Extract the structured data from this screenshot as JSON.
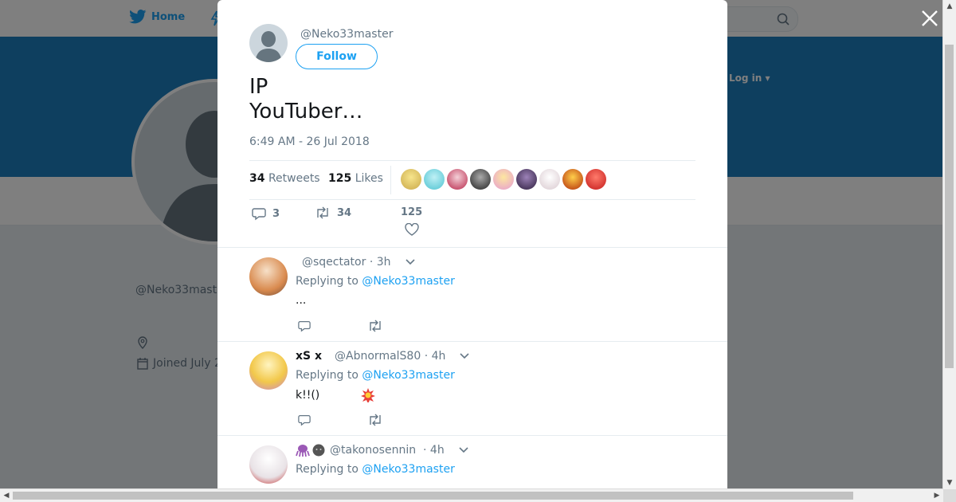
{
  "nav": {
    "home_label": "Home",
    "login_label": "Log in ▾"
  },
  "profile": {
    "name": "",
    "handle": "@Neko33mast",
    "joined": "Joined July 2"
  },
  "modal": {
    "handle": "@Neko33master",
    "follow_label": "Follow",
    "tweet_line1": "IP",
    "tweet_line2": "YouTuber…",
    "timestamp": "6:49 AM - 26 Jul 2018",
    "retweets_count": "34",
    "retweets_label": "Retweets",
    "likes_count": "125",
    "likes_label": "Likes",
    "actions": {
      "replies": "3",
      "retweets": "34",
      "likes": "125"
    }
  },
  "replies": [
    {
      "name": "",
      "handle": "@sqectator",
      "time": "· 3h",
      "replying_prefix": "Replying to",
      "replying_to": "@Neko33master",
      "text": "..."
    },
    {
      "name": "xS x",
      "handle": "@AbnormalS80",
      "time": "· 4h",
      "replying_prefix": "Replying to",
      "replying_to": "@Neko33master",
      "text": "k!!()"
    },
    {
      "name": "",
      "handle": "@takonosennin",
      "time": "· 4h",
      "replying_prefix": "Replying to",
      "replying_to": "@Neko33master",
      "text": ""
    }
  ],
  "colors": {
    "accent": "#1da1f2",
    "banner": "#1d7ebf"
  },
  "icons": [
    "twitter-bird-icon",
    "search-icon",
    "close-icon",
    "reply-icon",
    "retweet-icon",
    "heart-icon",
    "chevron-down-icon",
    "location-icon",
    "calendar-icon"
  ]
}
